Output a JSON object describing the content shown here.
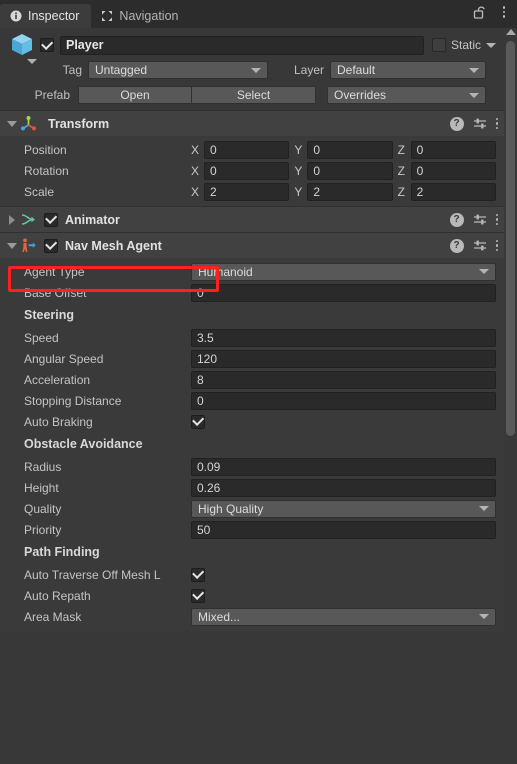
{
  "window": {
    "tabs": [
      {
        "label": "Inspector",
        "icon": "info-icon",
        "active": true
      },
      {
        "label": "Navigation",
        "icon": "move-tool-icon",
        "active": false
      }
    ],
    "lock_icon": "unlocked-padlock-icon",
    "menu_icon": "kebab-menu-icon"
  },
  "gameobject": {
    "icon": "prefab-cube-icon",
    "enabled": true,
    "name": "Player",
    "static_checked": false,
    "static_label": "Static",
    "tag_label": "Tag",
    "tag_value": "Untagged",
    "layer_label": "Layer",
    "layer_value": "Default",
    "prefab_label": "Prefab",
    "prefab_open": "Open",
    "prefab_select": "Select",
    "prefab_overrides": "Overrides"
  },
  "components": [
    {
      "name": "Transform",
      "icon": "transform-gizmo-icon",
      "expanded": true,
      "has_enable_toggle": false,
      "vectors": [
        {
          "label": "Position",
          "bold": true,
          "x": "0",
          "y": "0",
          "z": "0"
        },
        {
          "label": "Rotation",
          "bold": true,
          "x": "0",
          "y": "0",
          "z": "0"
        },
        {
          "label": "Scale",
          "bold": false,
          "x": "2",
          "y": "2",
          "z": "2"
        }
      ]
    },
    {
      "name": "Animator",
      "icon": "animator-icon",
      "expanded": false,
      "has_enable_toggle": true,
      "enabled": true
    },
    {
      "name": "Nav Mesh Agent",
      "icon": "navmesh-agent-icon",
      "expanded": true,
      "has_enable_toggle": true,
      "enabled": true,
      "highlighted": true,
      "rows": [
        {
          "kind": "dropdown",
          "label": "Agent Type",
          "value": "Humanoid"
        },
        {
          "kind": "field",
          "label": "Base Offset",
          "value": "0"
        },
        {
          "kind": "section",
          "label": "Steering"
        },
        {
          "kind": "field",
          "label": "Speed",
          "value": "3.5"
        },
        {
          "kind": "field",
          "label": "Angular Speed",
          "value": "120"
        },
        {
          "kind": "field",
          "label": "Acceleration",
          "value": "8"
        },
        {
          "kind": "field",
          "label": "Stopping Distance",
          "value": "0"
        },
        {
          "kind": "checkbox",
          "label": "Auto Braking",
          "checked": true
        },
        {
          "kind": "section",
          "label": "Obstacle Avoidance"
        },
        {
          "kind": "field",
          "label": "Radius",
          "value": "0.09"
        },
        {
          "kind": "field",
          "label": "Height",
          "value": "0.26"
        },
        {
          "kind": "dropdown",
          "label": "Quality",
          "value": "High Quality"
        },
        {
          "kind": "field",
          "label": "Priority",
          "value": "50"
        },
        {
          "kind": "section",
          "label": "Path Finding"
        },
        {
          "kind": "checkbox",
          "label": "Auto Traverse Off Mesh L",
          "checked": true
        },
        {
          "kind": "checkbox",
          "label": "Auto Repath",
          "checked": true
        },
        {
          "kind": "dropdown",
          "label": "Area Mask",
          "value": "Mixed..."
        }
      ]
    }
  ],
  "header_icons": {
    "help": "?",
    "preset": "preset-sliders-icon",
    "menu": "kebab-menu-icon"
  },
  "colors": {
    "panel": "#383838",
    "component_header": "#414141",
    "field": "#2a2a2a",
    "dropdown": "#585858",
    "highlight": "#ff2020",
    "text": "#c4c4c4"
  },
  "scrollbar": {
    "name": "vertical-scrollbar"
  }
}
